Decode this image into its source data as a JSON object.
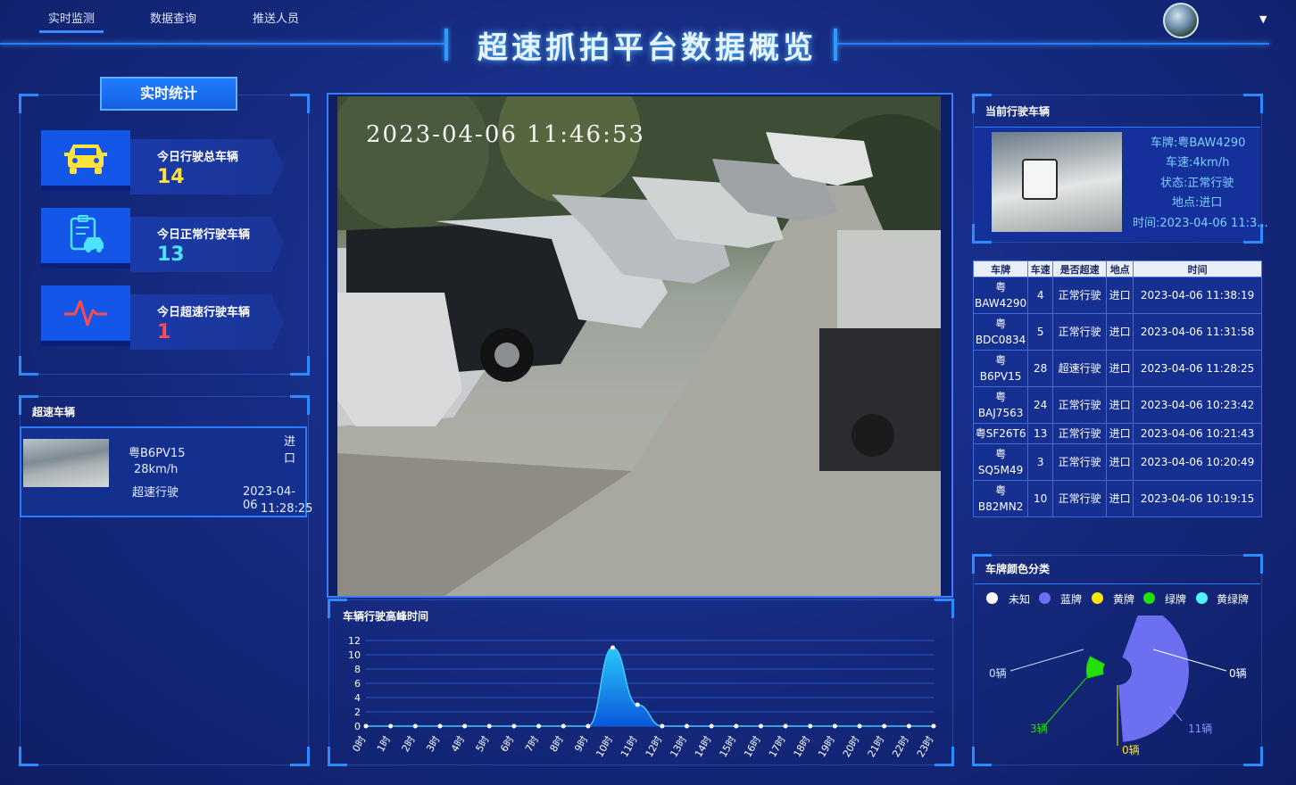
{
  "nav": {
    "items": [
      {
        "label": "实时监测",
        "active": true
      },
      {
        "label": "数据查询",
        "active": false
      },
      {
        "label": "推送人员",
        "active": false
      }
    ]
  },
  "header": {
    "title": "超速抓拍平台数据概览"
  },
  "stats": {
    "tab_label": "实时统计",
    "cards": [
      {
        "label": "今日行驶总车辆",
        "value": "14",
        "icon": "car-icon",
        "color": "#ffe33a"
      },
      {
        "label": "今日正常行驶车辆",
        "value": "13",
        "icon": "clipboard-car-icon",
        "color": "#4de3ff"
      },
      {
        "label": "今日超速行驶车辆",
        "value": "1",
        "icon": "pulse-icon",
        "color": "#ff4d4d"
      }
    ]
  },
  "speeding": {
    "title": "超速车辆",
    "item": {
      "plate": "粤B6PV15",
      "speed": "28km/h",
      "status": "超速行驶",
      "location": "进口",
      "date": "2023-04-06",
      "time": "11:28:25"
    }
  },
  "video": {
    "timestamp": "2023-04-06  11:46:53"
  },
  "peak_chart": {
    "title": "车辆行驶高峰时间"
  },
  "current": {
    "title": "当前行驶车辆",
    "plate": "车牌:粤BAW4290",
    "speed": "车速:4km/h",
    "status": "状态:正常行驶",
    "location": "地点:进口",
    "time": "时间:2023-04-06 11:3..."
  },
  "table": {
    "headers": [
      "车牌",
      "车速",
      "是否超速",
      "地点",
      "时间"
    ],
    "rows": [
      [
        "粤BAW4290",
        "4",
        "正常行驶",
        "进口",
        "2023-04-06 11:38:19"
      ],
      [
        "粤BDC0834",
        "5",
        "正常行驶",
        "进口",
        "2023-04-06 11:31:58"
      ],
      [
        "粤B6PV15",
        "28",
        "超速行驶",
        "进口",
        "2023-04-06 11:28:25"
      ],
      [
        "粤BAJ7563",
        "24",
        "正常行驶",
        "进口",
        "2023-04-06 10:23:42"
      ],
      [
        "粤SF26T6",
        "13",
        "正常行驶",
        "进口",
        "2023-04-06 10:21:43"
      ],
      [
        "粤SQ5M49",
        "3",
        "正常行驶",
        "进口",
        "2023-04-06 10:20:49"
      ],
      [
        "粤B82MN2",
        "10",
        "正常行驶",
        "进口",
        "2023-04-06 10:19:15"
      ]
    ]
  },
  "plate_colors": {
    "title": "车牌颜色分类",
    "legend": [
      {
        "name": "未知",
        "color": "#ffffff"
      },
      {
        "name": "蓝牌",
        "color": "#6b6ff0"
      },
      {
        "name": "黄牌",
        "color": "#ffe600"
      },
      {
        "name": "绿牌",
        "color": "#22e000"
      },
      {
        "name": "黄绿牌",
        "color": "#52f5ff"
      }
    ],
    "labels": {
      "unknown": "0辆",
      "blue": "11辆",
      "yellow": "0辆",
      "green": "3辆",
      "yellowgreen": "0辆"
    }
  },
  "chart_data": [
    {
      "type": "area",
      "title": "车辆行驶高峰时间",
      "categories": [
        "0时",
        "1时",
        "2时",
        "3时",
        "4时",
        "5时",
        "6时",
        "7时",
        "8时",
        "9时",
        "10时",
        "11时",
        "12时",
        "13时",
        "14时",
        "15时",
        "16时",
        "17时",
        "18时",
        "19时",
        "20时",
        "21时",
        "22时",
        "23时"
      ],
      "values": [
        0,
        0,
        0,
        0,
        0,
        0,
        0,
        0,
        0,
        0,
        11,
        3,
        0,
        0,
        0,
        0,
        0,
        0,
        0,
        0,
        0,
        0,
        0,
        0
      ],
      "yticks": [
        0,
        2,
        4,
        6,
        8,
        10,
        12
      ],
      "ylim": [
        0,
        12
      ],
      "color": "#1aa0ff",
      "grid": true
    },
    {
      "type": "pie",
      "title": "车牌颜色分类",
      "categories": [
        "未知",
        "蓝牌",
        "黄牌",
        "绿牌",
        "黄绿牌"
      ],
      "values": [
        0,
        11,
        0,
        3,
        0
      ],
      "colors": [
        "#ffffff",
        "#6b6ff0",
        "#ffe600",
        "#22e000",
        "#52f5ff"
      ],
      "rose": true
    }
  ]
}
